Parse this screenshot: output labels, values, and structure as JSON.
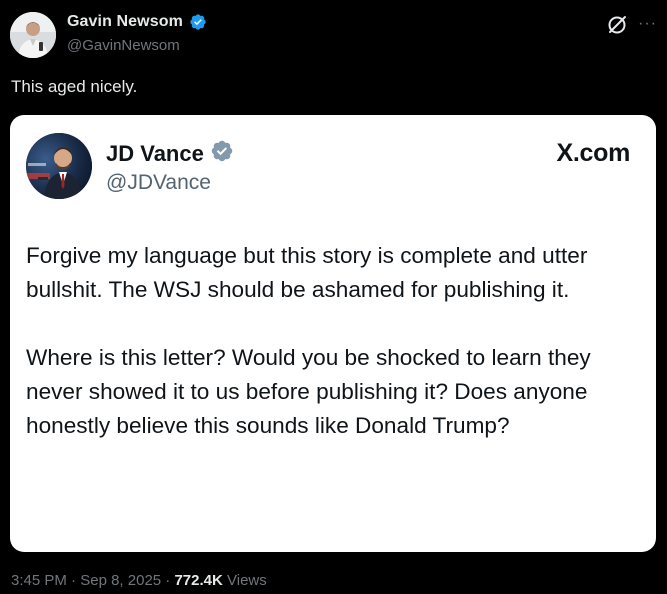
{
  "post": {
    "author": {
      "name": "Gavin Newsom",
      "handle": "@GavinNewsom",
      "verified": true,
      "avatar": "person-avatar"
    },
    "text": "This aged nicely.",
    "actions": {
      "grok_icon": "grok-icon",
      "more_icon": "more-icon",
      "more_glyph": "···"
    },
    "footer": {
      "time": "3:45 PM",
      "separator": "·",
      "date": "Sep 8, 2025",
      "views_count": "772.4K",
      "views_label": "Views"
    }
  },
  "quoted": {
    "author": {
      "name": "JD Vance",
      "handle": "@JDVance",
      "verified": true,
      "avatar": "person-avatar"
    },
    "brand": "X.com",
    "paragraphs": [
      "Forgive my language but this story is complete and utter bullshit. The WSJ should be ashamed for publishing it.",
      "Where is this letter? Would you be shocked to learn they never showed it to us before publishing it? Does anyone honestly believe this sounds like Donald Trump?"
    ]
  },
  "colors": {
    "background": "#000000",
    "primary_text": "#e7e9ea",
    "secondary_text": "#71767b",
    "verified_blue": "#1d9bf0",
    "card_background": "#ffffff",
    "card_text": "#0f1419",
    "card_secondary_text": "#536471"
  }
}
